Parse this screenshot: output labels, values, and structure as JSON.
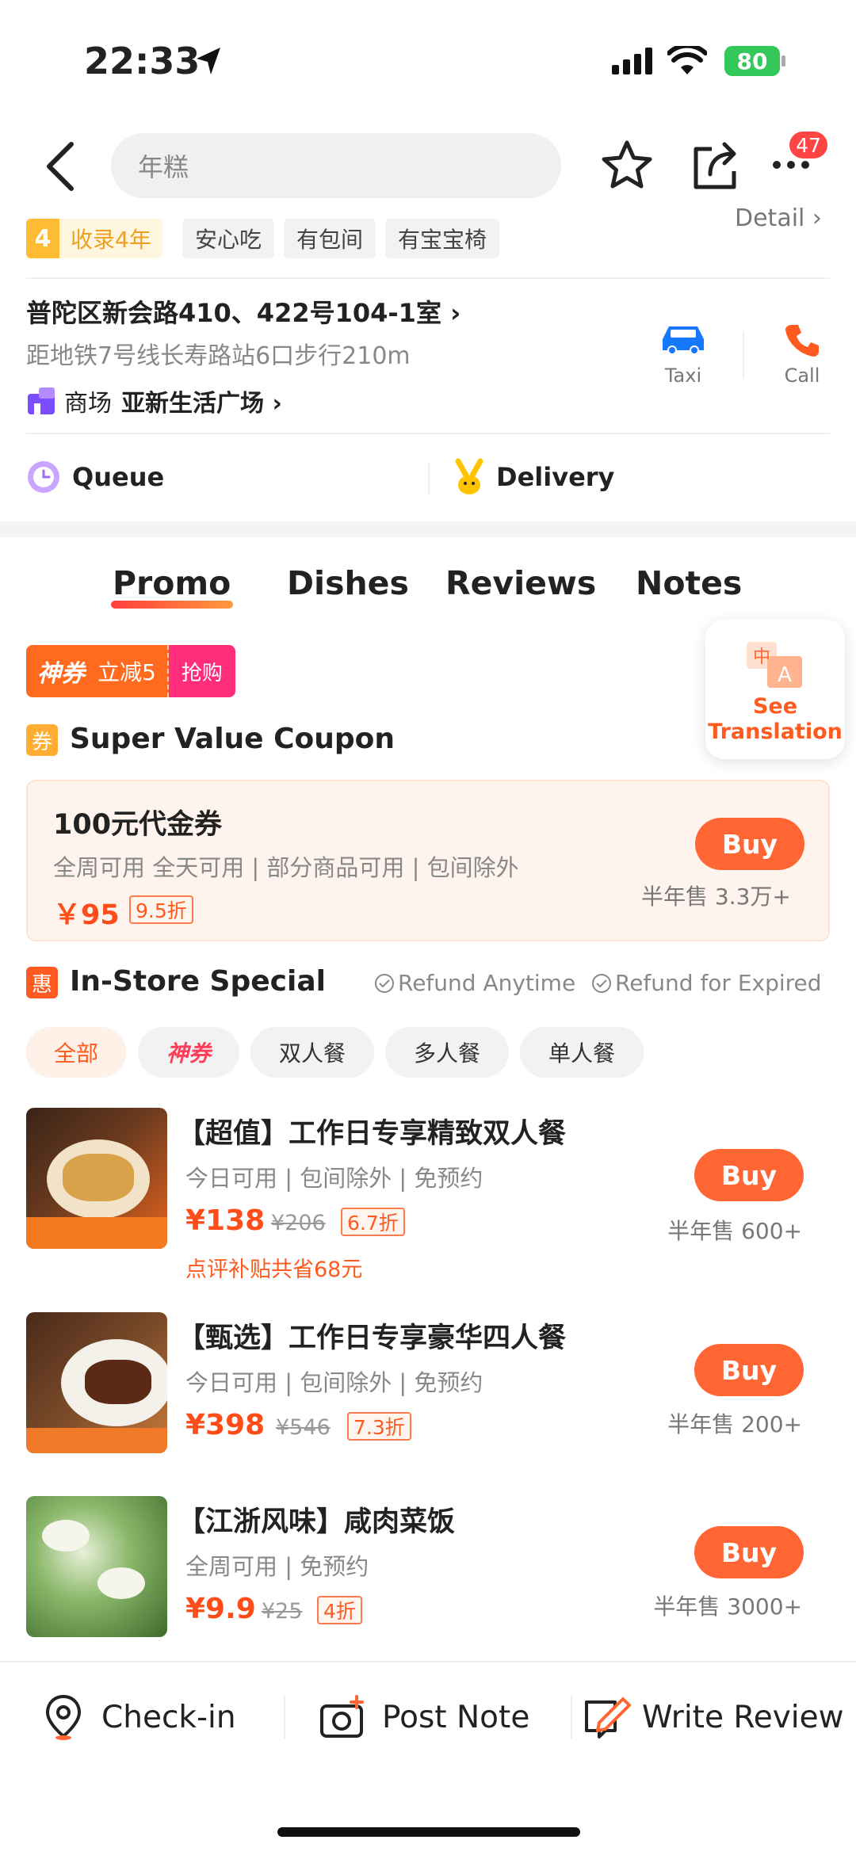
{
  "status_bar": {
    "time": "22:33",
    "battery": "80"
  },
  "header": {
    "search_text": "年糕",
    "badge_count": "47"
  },
  "tags": {
    "level": "4",
    "years": "收录4年",
    "t1": "安心吃",
    "t2": "有包间",
    "t3": "有宝宝椅",
    "detail": "Detail ›"
  },
  "address": {
    "line": "普陀区新会路410、422号104-1室 ›",
    "metro": "距地铁7号线长寿路站6口步行210m",
    "mall_prefix": "商场",
    "mall_name": "亚新生活广场 ›",
    "taxi": "Taxi",
    "call": "Call"
  },
  "services": {
    "queue": "Queue",
    "delivery": "Delivery"
  },
  "tabs": [
    {
      "label": "Promo"
    },
    {
      "label": "Dishes"
    },
    {
      "label": "Reviews"
    },
    {
      "label": "Notes"
    }
  ],
  "translate": {
    "label_line1": "See",
    "label_line2": "Translation"
  },
  "promo_banner": {
    "left": "神券",
    "mid": "立减5",
    "right": "抢购"
  },
  "coupon_section": {
    "icon": "券",
    "title": "Super Value Coupon",
    "name": "100元代金券",
    "desc": "全周可用 全天可用 | 部分商品可用 | 包间除外",
    "price": "￥95",
    "discount": "9.5折",
    "buy": "Buy",
    "sold": "半年售 3.3万+"
  },
  "instore": {
    "icon": "惠",
    "title": "In-Store Special",
    "refund1": "Refund Anytime",
    "refund2": "Refund for Expired"
  },
  "filters": [
    {
      "label": "全部"
    },
    {
      "label": "神券"
    },
    {
      "label": "双人餐"
    },
    {
      "label": "多人餐"
    },
    {
      "label": "单人餐"
    }
  ],
  "deals": [
    {
      "title": "【超值】工作日专享精致双人餐",
      "desc": "今日可用 | 包间除外 | 免预约",
      "price": "¥138",
      "original": "¥206",
      "discount": "6.7折",
      "subsidy": "点评补贴共省68元",
      "buy": "Buy",
      "sold": "半年售 600+"
    },
    {
      "title": "【甄选】工作日专享豪华四人餐",
      "desc": "今日可用 | 包间除外 | 免预约",
      "price": "¥398",
      "original": "¥546",
      "discount": "7.3折",
      "buy": "Buy",
      "sold": "半年售 200+"
    },
    {
      "title": "【江浙风味】咸肉菜饭",
      "desc": "全周可用 | 免预约",
      "price": "¥9.9",
      "original": "¥25",
      "discount": "4折",
      "buy": "Buy",
      "sold": "半年售 3000+"
    }
  ],
  "bottom_bar": {
    "checkin": "Check-in",
    "post_note": "Post Note",
    "write_review": "Write Review"
  },
  "colors": {
    "accent": "#ff6633",
    "price": "#ff4d1a",
    "tab_underline": "#ff6633"
  }
}
